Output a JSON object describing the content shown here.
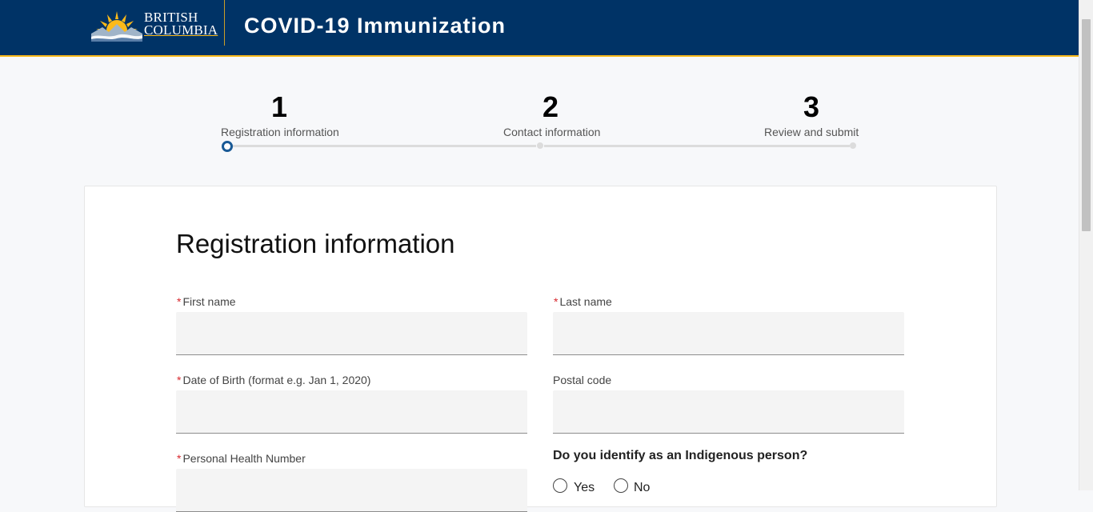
{
  "header": {
    "logo_line1": "BRITISH",
    "logo_line2": "COLUMBIA",
    "title": "COVID-19 Immunization"
  },
  "stepper": {
    "current_step": 1,
    "steps": [
      {
        "number": "1",
        "label": "Registration information"
      },
      {
        "number": "2",
        "label": "Contact information"
      },
      {
        "number": "3",
        "label": "Review and submit"
      }
    ]
  },
  "form": {
    "title": "Registration information",
    "required_marker": "*",
    "fields": {
      "first_name": {
        "label": "First name",
        "value": ""
      },
      "last_name": {
        "label": "Last name",
        "value": ""
      },
      "dob": {
        "label": "Date of Birth (format e.g. Jan 1, 2020)",
        "value": ""
      },
      "postal_code": {
        "label": "Postal code",
        "value": ""
      },
      "phn": {
        "label": "Personal Health Number",
        "value": ""
      }
    },
    "indigenous": {
      "question": "Do you identify as an Indigenous person?",
      "options": [
        "Yes",
        "No"
      ]
    }
  },
  "colors": {
    "header_bg": "#003366",
    "accent_gold": "#fcba19",
    "active_step": "#1a5a96",
    "required": "#d8292f"
  }
}
